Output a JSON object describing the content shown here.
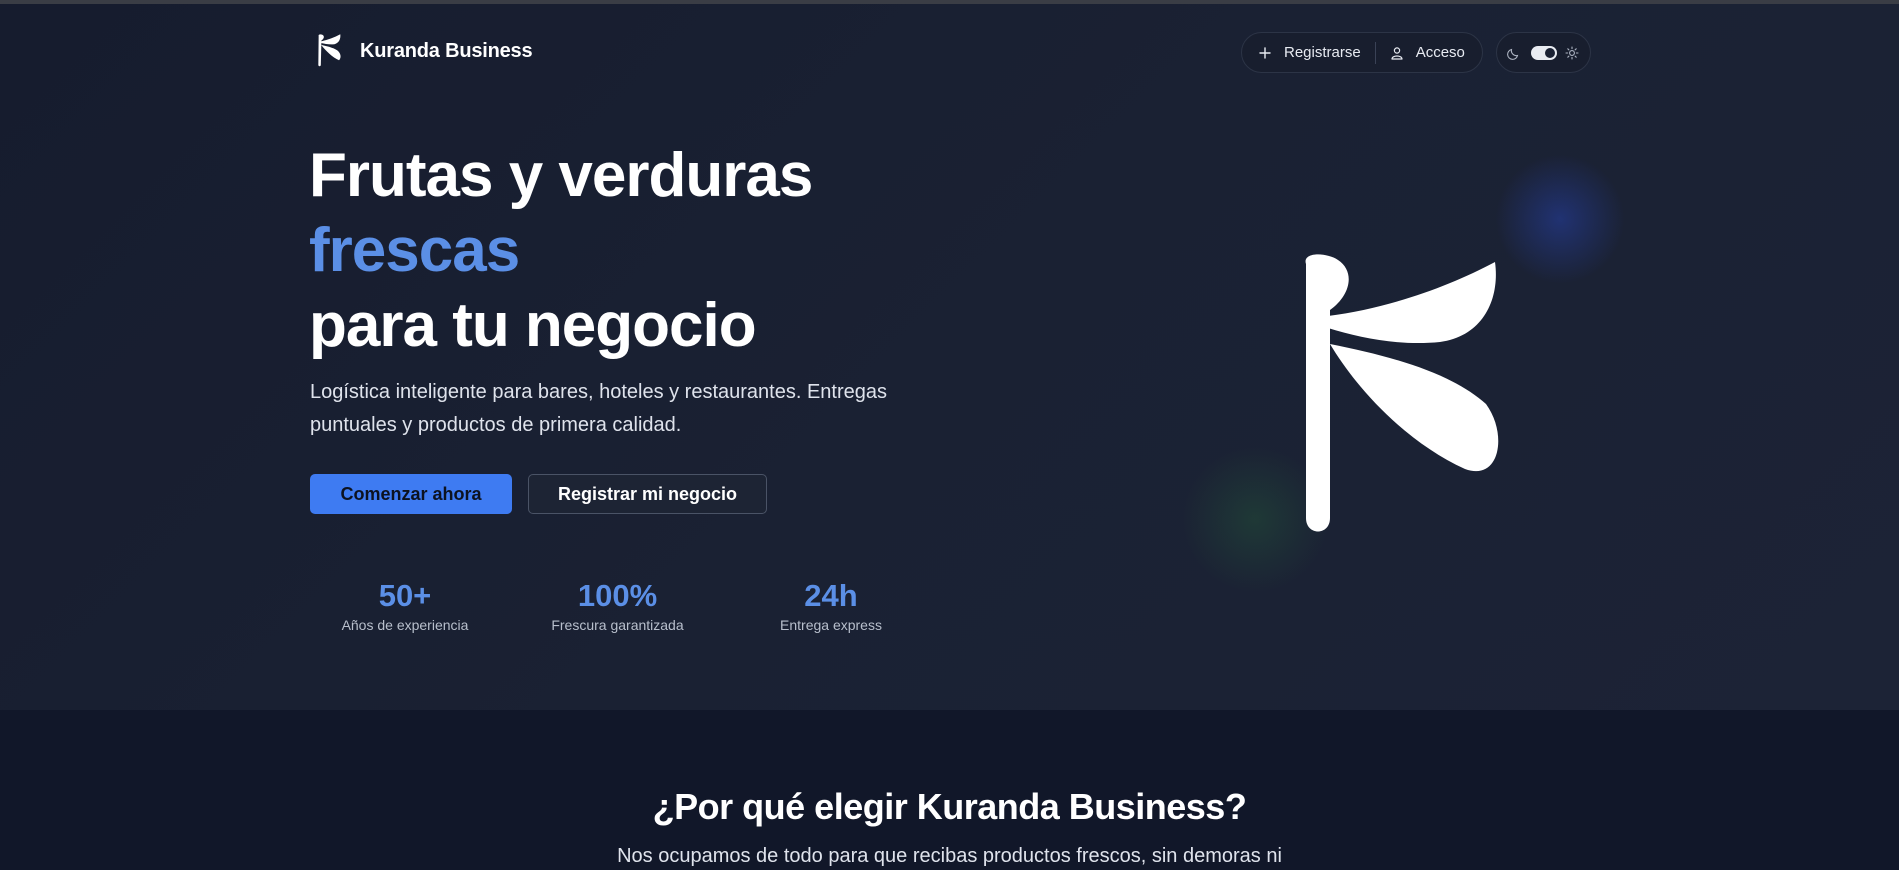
{
  "brand": {
    "name": "Kuranda Business"
  },
  "nav": {
    "register_label": "Registrarse",
    "login_label": "Acceso"
  },
  "hero": {
    "headline_line1": "Frutas y verduras",
    "headline_accent": "frescas",
    "headline_line3": "para tu negocio",
    "subtitle": "Logística inteligente para bares, hoteles y restaurantes. Entregas puntuales y productos de primera calidad.",
    "primary_cta": "Comenzar ahora",
    "secondary_cta": "Registrar mi negocio",
    "stats": [
      {
        "value": "50+",
        "label": "Años de experiencia"
      },
      {
        "value": "100%",
        "label": "Frescura garantizada"
      },
      {
        "value": "24h",
        "label": "Entrega express"
      }
    ]
  },
  "why": {
    "title": "¿Por qué elegir Kuranda Business?",
    "subtitle": "Nos ocupamos de todo para que recibas productos frescos, sin demoras ni"
  },
  "colors": {
    "accent": "#5b8fe6",
    "primary_button": "#3e7bf2",
    "background": "#141a2a"
  },
  "icons": {
    "register": "plus-icon",
    "login": "user-icon",
    "dark_mode": "moon-icon",
    "light_mode": "sun-icon"
  },
  "theme": {
    "mode": "dark"
  }
}
